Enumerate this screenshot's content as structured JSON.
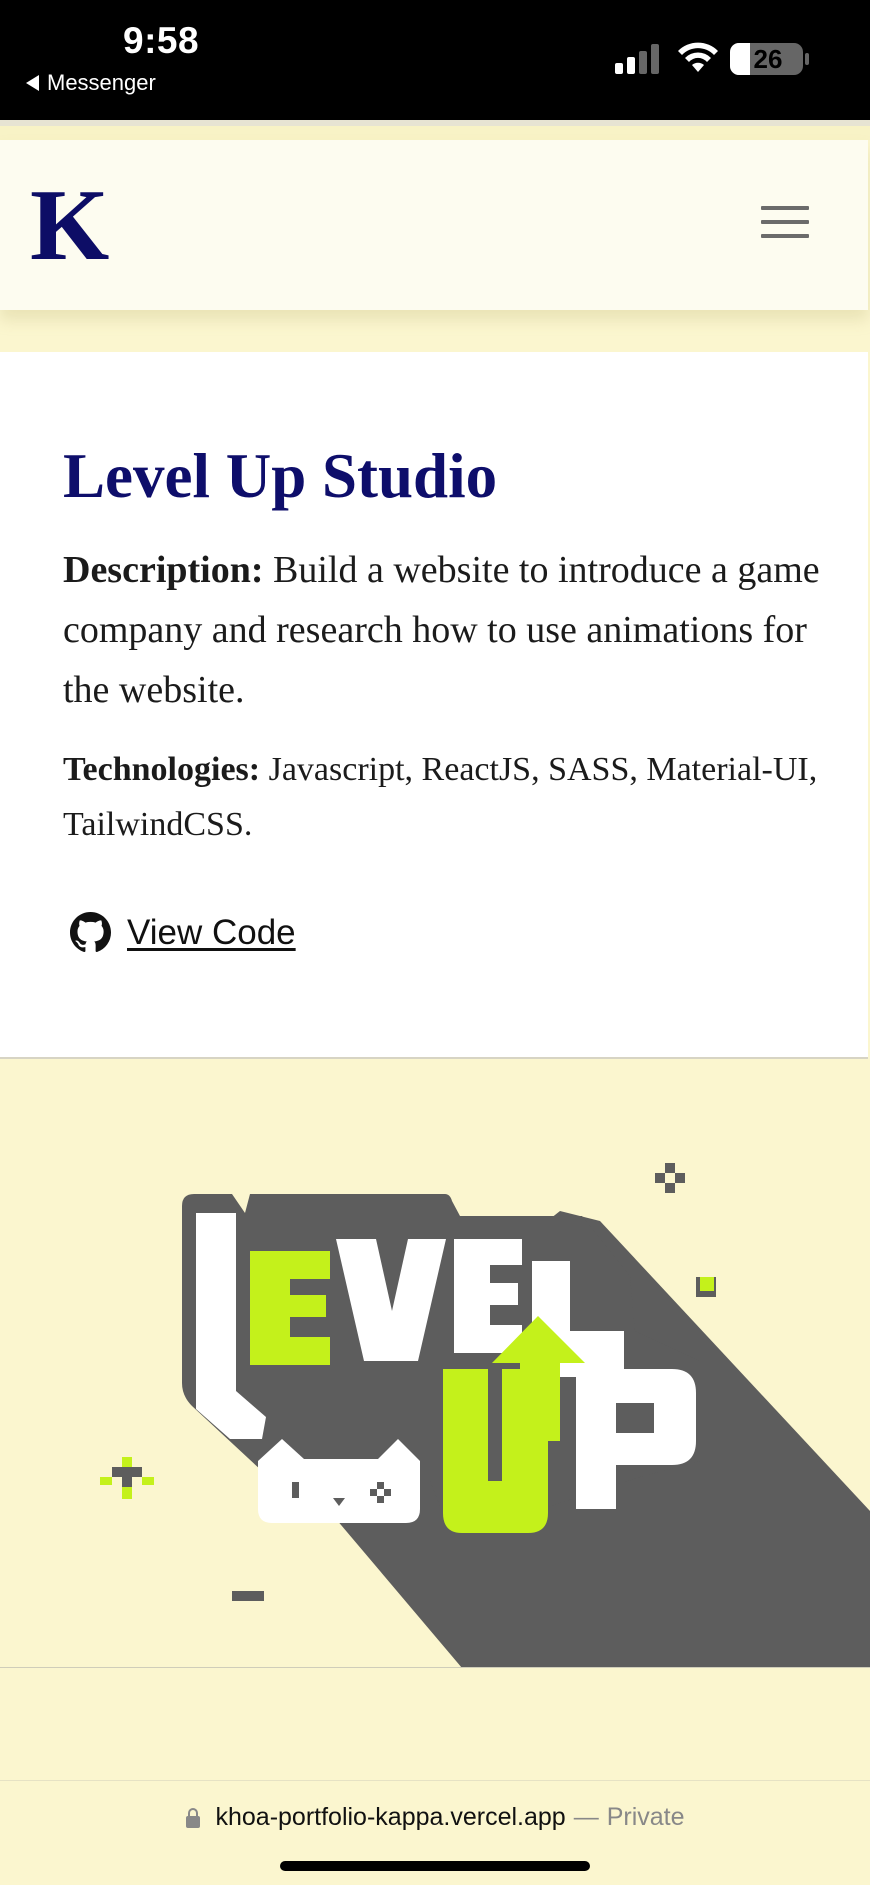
{
  "status_bar": {
    "time": "9:58",
    "back_app": "Messenger",
    "battery_level": "26",
    "signal_icon": "cellular-signal-icon",
    "wifi_icon": "wifi-icon"
  },
  "navbar": {
    "logo": "K",
    "menu_icon": "hamburger-menu-icon"
  },
  "project": {
    "title": "Level Up Studio",
    "description_label": "Description:",
    "description": "Build a website to introduce a game company and research how to use animations for the website.",
    "technologies_label": "Technologies:",
    "technologies": "Javascript, ReactJS, SASS, Material-UI, TailwindCSS.",
    "view_code_label": "View Code",
    "view_code_icon": "github-icon",
    "preview_logo_text": "LEVEL UP"
  },
  "browser": {
    "url": "khoa-portfolio-kappa.vercel.app",
    "separator": "—",
    "mode": "Private",
    "lock_icon": "lock-icon"
  },
  "colors": {
    "title_navy": "#0e0e6b",
    "page_bg": "#fbf6cf",
    "lime": "#c4f11b",
    "shadow_gray": "#5d5d5d"
  }
}
